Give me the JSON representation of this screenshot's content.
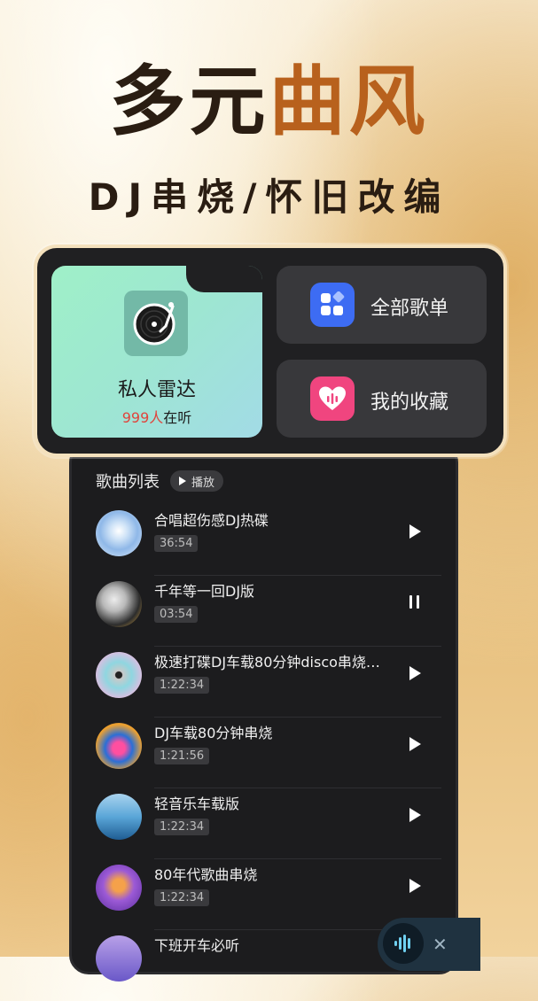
{
  "headline": {
    "part1": "多元",
    "part2": "曲风"
  },
  "subline": "DJ串烧/怀旧改编",
  "radar": {
    "label": "私人雷达",
    "count": "999人",
    "count_suffix": "在听"
  },
  "tiles": [
    {
      "label": "全部歌单",
      "icon": "grid-icon",
      "color": "#3d6cf3"
    },
    {
      "label": "我的收藏",
      "icon": "heart-icon",
      "color": "#f0457f"
    }
  ],
  "list": {
    "title": "歌曲列表",
    "play_label": "播放",
    "songs": [
      {
        "title": "合唱超伤感DJ热碟",
        "duration": "36:54",
        "state": "play"
      },
      {
        "title": "千年等一回DJ版",
        "duration": "03:54",
        "state": "pause"
      },
      {
        "title": "极速打碟DJ车载80分钟disco串烧…",
        "duration": "1:22:34",
        "state": "play"
      },
      {
        "title": "DJ车载80分钟串烧",
        "duration": "1:21:56",
        "state": "play"
      },
      {
        "title": "轻音乐车载版",
        "duration": "1:22:34",
        "state": "play"
      },
      {
        "title": "80年代歌曲串烧",
        "duration": "1:22:34",
        "state": "play"
      },
      {
        "title": "下班开车必听",
        "duration": "",
        "state": ""
      }
    ]
  },
  "mini_player": {
    "close": "✕"
  },
  "colors": {
    "accent_orange": "#b8611d",
    "highlight_red": "#e0443c"
  }
}
